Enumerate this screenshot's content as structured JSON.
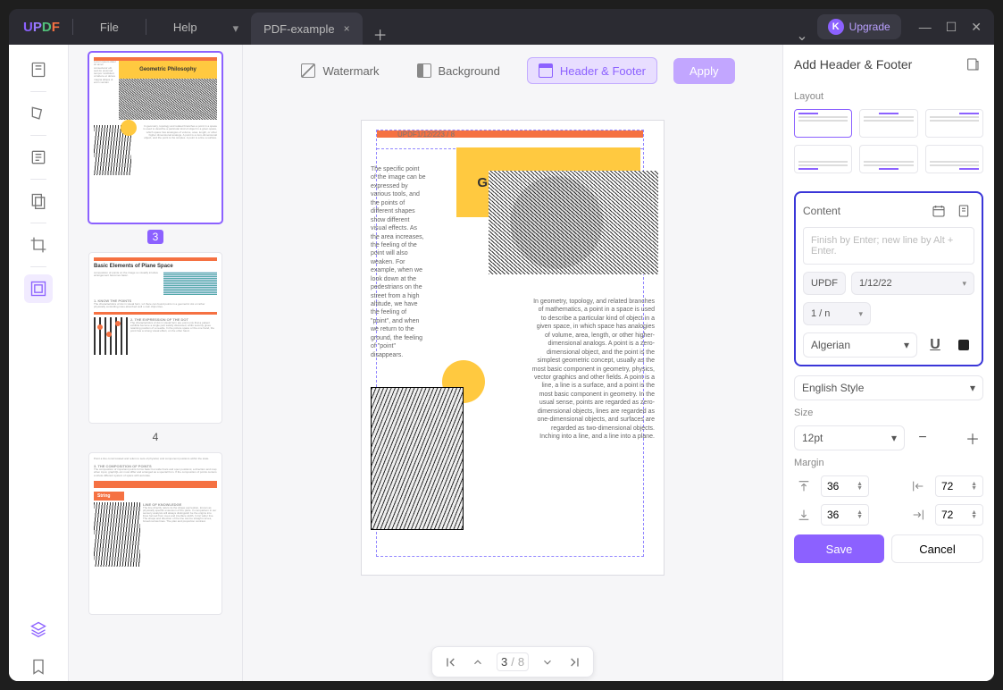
{
  "menu": {
    "file": "File",
    "help": "Help"
  },
  "tab": {
    "name": "PDF-example",
    "close": "×",
    "dropdown": "▾",
    "new": "＋"
  },
  "upgrade": {
    "letter": "K",
    "label": "Upgrade"
  },
  "wc": {
    "min": "—",
    "max": "☐",
    "close": "✕",
    "caret": "⌄"
  },
  "tools": {
    "reader": "",
    "comment": "",
    "edit": "",
    "ocr": "",
    "crop": "",
    "page": "",
    "bookmark": ""
  },
  "thumbs": {
    "p3": {
      "label": "3",
      "title": "Geometric Philosophy"
    },
    "p4": {
      "label": "4",
      "title": "Basic Elements of Plane Space",
      "h1": "1. KNOW THE POINTS",
      "h2": "2. THE EXPRESSION OF THE DOT"
    },
    "p5": {
      "h3": "3. THE COMPOSITION OF POINTS",
      "stringbar": "String",
      "lok": "LINE OF KNOWLEDGE"
    }
  },
  "optbar": {
    "watermark": "Watermark",
    "background": "Background",
    "headerfooter": "Header & Footer",
    "apply": "Apply"
  },
  "doc": {
    "header": "UPDF1/12/223 / 8",
    "title": "Geometric Philosophy",
    "left_text": "The specific point of the image can be expressed by various tools, and the points of different shapes show different visual effects. As the area increases, the feeling of the point will also weaken. For example, when we look down at the pedestrians on the street from a high altitude, we have the feeling of \"point\", and when we return to the ground, the feeling of \"point\" disappears.",
    "right_text": "In geometry, topology, and related branches of mathematics, a point in a space is used to describe a particular kind of object in a given space, in which space has analogies of volume, area, length, or other higher-dimensional analogs. A point is a zero-dimensional object, and the point is the simplest geometric concept, usually as the most basic component in geometry, physics, vector graphics and other fields. A point is a line, a line is a surface, and a point is the most basic component in geometry. In the usual sense, points are regarded as zero-dimensional objects, lines are regarded as one-dimensional objects, and surfaces are regarded as two-dimensional objects. Inching into a line, and a line into a plane."
  },
  "pager": {
    "first": "⤒",
    "prev": "︿",
    "cur": "3",
    "sep": "/",
    "tot": "8",
    "next": "﹀",
    "last": "⤓"
  },
  "panel": {
    "title": "Add Header & Footer",
    "save_tmpl_icon": "⎘",
    "layout": "Layout",
    "content": {
      "label": "Content",
      "date_icon": "📅",
      "page_icon": "📄",
      "placeholder": "Finish by Enter; new line by Alt + Enter.",
      "brand": "UPDF",
      "date": "1/12/22",
      "page": "1 / n",
      "font": "Algerian"
    },
    "numstyle": "English Style",
    "size": {
      "label": "Size",
      "val": "12pt"
    },
    "margin": {
      "label": "Margin",
      "top": "36",
      "bottom": "36",
      "left": "72",
      "right": "72"
    },
    "save": "Save",
    "cancel": "Cancel"
  }
}
